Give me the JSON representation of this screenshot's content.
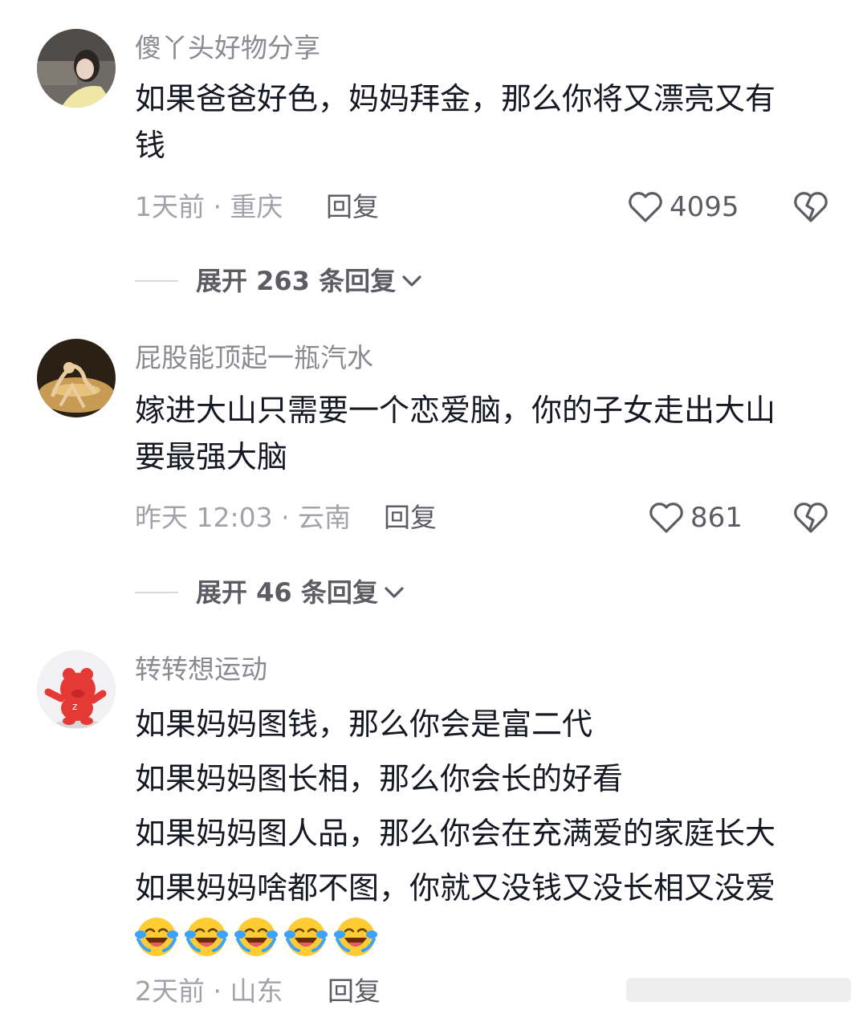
{
  "comments": [
    {
      "username": "傻丫头好物分享",
      "lines": [
        "如果爸爸好色，妈妈拜金，那么你将又漂亮又有",
        "钱"
      ],
      "meta": "1天前 · 重庆",
      "reply_label": "回复",
      "likes": "4095",
      "expand_label": "展开 263 条回复"
    },
    {
      "username": "屁股能顶起一瓶汽水",
      "lines": [
        "嫁进大山只需要一个恋爱脑，你的子女走出大山",
        "要最强大脑"
      ],
      "meta": "昨天 12:03 · 云南",
      "reply_label": "回复",
      "likes": "861",
      "expand_label": "展开 46 条回复"
    },
    {
      "username": "转转想运动",
      "lines": [
        "如果妈妈图钱，那么你会是富二代",
        "如果妈妈图长相，那么你会长的好看",
        "如果妈妈图人品，那么你会在充满爱的家庭长大",
        "如果妈妈啥都不图，你就又没钱又没长相又没爱"
      ],
      "emoji_count": 5,
      "emoji_name": "laugh-cry",
      "meta": "2天前 · 山东",
      "reply_label": "回复"
    }
  ],
  "icons": {
    "like": "heart-outline-icon",
    "dislike": "broken-heart-icon",
    "expand": "chevron-down-icon"
  },
  "colors": {
    "text": "#161823",
    "secondary": "#8a8b91",
    "meta": "#a2a3a8",
    "action": "#5c5d63"
  }
}
